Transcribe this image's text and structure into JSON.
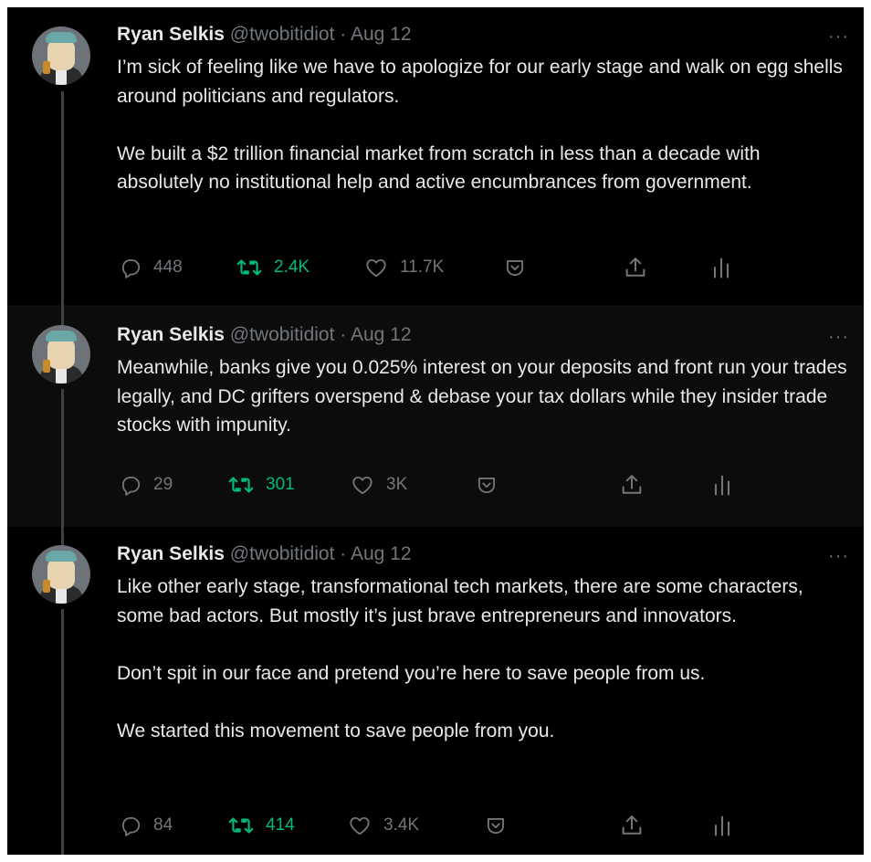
{
  "tweets": [
    {
      "author_name": "Ryan Selkis",
      "handle": "@twobitidiot",
      "separator": "·",
      "date": "Aug 12",
      "paragraphs": [
        "I’m sick of feeling like we have to apologize for our early stage and walk on egg shells around politicians and regulators.",
        "We built a $2 trillion financial market from scratch in less than a decade with absolutely no institutional help and active encumbrances from government."
      ],
      "replies": "448",
      "retweets": "2.4K",
      "likes": "11.7K"
    },
    {
      "author_name": "Ryan Selkis",
      "handle": "@twobitidiot",
      "separator": "·",
      "date": "Aug 12",
      "paragraphs": [
        "Meanwhile, banks give you 0.025% interest on your deposits and front run your trades legally, and DC grifters overspend & debase your tax dollars while they insider trade stocks with impunity."
      ],
      "replies": "29",
      "retweets": "301",
      "likes": "3K"
    },
    {
      "author_name": "Ryan Selkis",
      "handle": "@twobitidiot",
      "separator": "·",
      "date": "Aug 12",
      "paragraphs": [
        "Like other early stage, transformational tech markets, there are some characters, some bad actors. But mostly it’s just brave entrepreneurs and innovators.",
        "Don’t spit in our face and pretend you’re here to save people from us.",
        "We started this movement to save people from you."
      ],
      "replies": "84",
      "retweets": "414",
      "likes": "3.4K"
    }
  ],
  "more_glyph": "···",
  "icons": {
    "reply": "reply-icon",
    "retweet": "retweet-icon",
    "like": "heart-icon",
    "tip": "tip-icon",
    "share": "share-icon",
    "analytics": "analytics-icon"
  },
  "colors": {
    "background": "#000000",
    "text": "#e7e9ea",
    "muted": "#71767b",
    "retweet_green": "#00ba7c"
  }
}
